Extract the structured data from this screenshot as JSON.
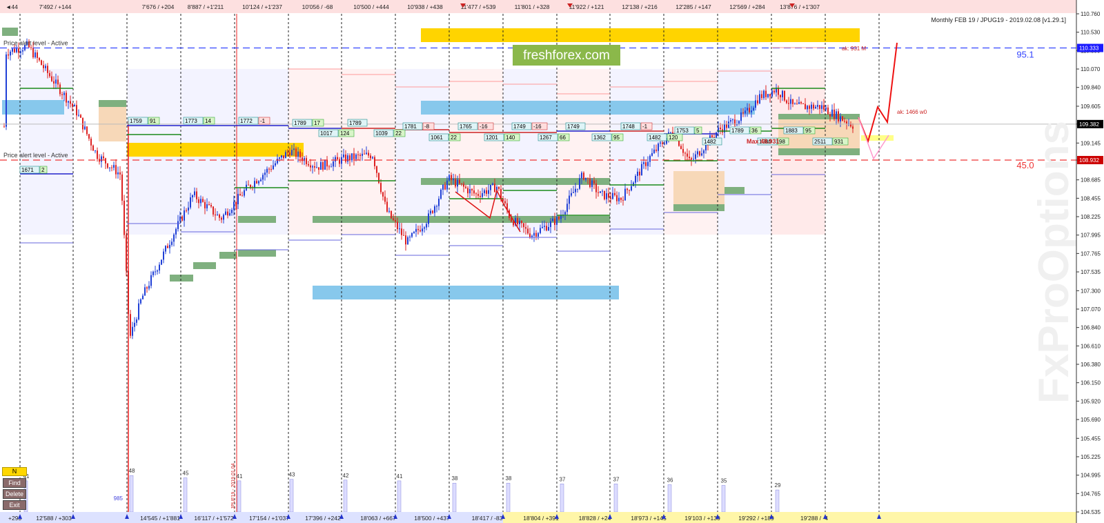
{
  "chart_data": {
    "type": "candlestick",
    "title": "Monthly FEB 19 / JPUG19 - 2019.02.08 [v1.29.1]",
    "watermark": "FxProOptions",
    "brand": "freshforex.com",
    "ylim": [
      104.535,
      110.76
    ],
    "y_ticks": [
      "110.760",
      "110.530",
      "110.300",
      "110.070",
      "109.840",
      "109.605",
      "109.382",
      "109.145",
      "108.932",
      "108.685",
      "108.455",
      "108.225",
      "107.995",
      "107.765",
      "107.535",
      "107.300",
      "107.070",
      "106.840",
      "106.610",
      "106.380",
      "106.150",
      "105.920",
      "105.690",
      "105.455",
      "105.225",
      "104.995",
      "104.765",
      "104.535"
    ],
    "price_marks": [
      {
        "label": "110.333",
        "value": 110.333,
        "color": "#1a1aff"
      },
      {
        "label": "109.382",
        "value": 109.382,
        "color": "#000000"
      },
      {
        "label": "108.932",
        "value": 108.932,
        "color": "#cc0000"
      }
    ],
    "levels": [
      {
        "value": 110.333,
        "label": "Price alert level - Active",
        "pct": "95.1",
        "color": "#3344ff"
      },
      {
        "value": 108.932,
        "label": "Price alert level - Active",
        "pct": "45.0",
        "color": "#ee3333"
      }
    ],
    "top_labels": [
      "◄44",
      "7'492 / +144",
      "7'676 / +204",
      "8'887 / +1'211",
      "10'124 / +1'237",
      "10'056 / -68",
      "10'500 / +444",
      "10'938 / +438",
      "11'477 / +539",
      "11'801 / +328",
      "11'922 / +121",
      "12'138 / +216",
      "12'285 / +147",
      "12'569 / +284",
      "13'876 / +1'307"
    ],
    "bottom_labels": [
      "+293",
      "12'588 / +303",
      "14'545 / +1'881",
      "16'117 / +1'572",
      "17'154 / +1'037",
      "17'396 / +242",
      "18'063 / +667",
      "18'500 / +437",
      "18'417 / -83",
      "18'804 / +391",
      "18'828 / +24",
      "18'973 / +145",
      "19'103 / +130",
      "19'292 / +189",
      "19'288 / -4"
    ],
    "volume_labels": [
      "41",
      "48",
      "45",
      "41",
      "43",
      "42",
      "41",
      "38",
      "38",
      "37",
      "37",
      "36",
      "35",
      "29"
    ],
    "side_note": "985",
    "date_label": "JPUF19 - 2019.01.04",
    "box_labels": [
      {
        "t": "1759",
        "v": "91"
      },
      {
        "t": "1773",
        "v": "14"
      },
      {
        "t": "1772",
        "v": "-1"
      },
      {
        "t": "1789",
        "v": "17"
      },
      {
        "t": "1017",
        "v": "124"
      },
      {
        "t": "1789",
        "v": ""
      },
      {
        "t": "1039",
        "v": "22"
      },
      {
        "t": "1781",
        "v": "-8"
      },
      {
        "t": "1061",
        "v": "22"
      },
      {
        "t": "1765",
        "v": "-16"
      },
      {
        "t": "1201",
        "v": "140"
      },
      {
        "t": "1749",
        "v": "-16"
      },
      {
        "t": "1267",
        "v": "66"
      },
      {
        "t": "1749",
        "v": ""
      },
      {
        "t": "1362",
        "v": "95"
      },
      {
        "t": "1748",
        "v": "-1"
      },
      {
        "t": "1482",
        "v": "120"
      },
      {
        "t": "1753",
        "v": "5"
      },
      {
        "t": "1482",
        "v": ""
      },
      {
        "t": "1789",
        "v": "36"
      },
      {
        "t": "1883",
        "v": "95"
      },
      {
        "t": "1980",
        "v": "98"
      },
      {
        "t": "2511",
        "v": "931"
      },
      {
        "t": "1671",
        "v": "2"
      }
    ],
    "annotations": [
      "ak: 931 M",
      "ak: 1466 w0",
      "Max 48.931"
    ],
    "legend": "none",
    "grid": "vertical dotted separators"
  },
  "buttons": {
    "n": "N",
    "find": "Find",
    "delete": "Delete",
    "exit": "Exit"
  },
  "colors": {
    "bull": "#1f3fd6",
    "bear": "#dd2222",
    "panel_blue": "#87c8ec",
    "panel_yellow": "#ffd400",
    "panel_green": "#7fb07f",
    "panel_peach": "#f7d8b8",
    "brand_bg": "#8bb84a"
  }
}
